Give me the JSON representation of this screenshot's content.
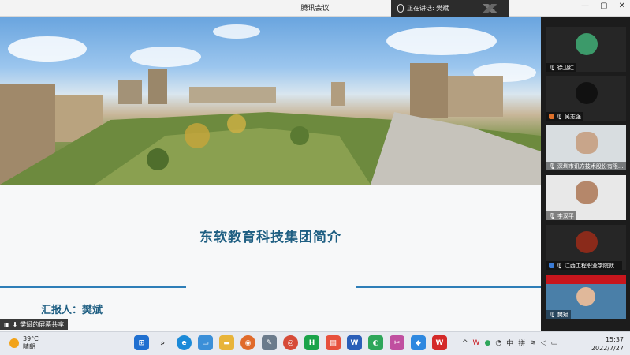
{
  "window": {
    "title": "腾讯会议",
    "speaking_label": "正在讲话: 樊斌",
    "controls": [
      "—",
      "▢",
      "✕"
    ]
  },
  "slide": {
    "heading": "东软教育科技集团简介",
    "reporter": "汇报人：樊斌"
  },
  "share_tag": "樊斌的屏幕共享",
  "participants": [
    {
      "name": "徐卫红",
      "accent": "#2e8b57"
    },
    {
      "name": "吴志强",
      "accent": "#e0712a"
    },
    {
      "name": "深圳市讯方技术股份有限...",
      "accent": "#3a7bd5"
    },
    {
      "name": "李汉平",
      "accent": "#3a7bd5"
    },
    {
      "name": "江西工程职业学院就...",
      "accent": "#3a7bd5"
    },
    {
      "name": "樊斌",
      "accent": "#2e8b57"
    }
  ],
  "taskbar": {
    "temperature": "39°C",
    "weather": "晴朗",
    "ime": "中",
    "ime2": "拼",
    "time": "15:37",
    "date": "2022/7/27"
  },
  "colors": {
    "accent": "#1e5e82",
    "rule": "#2e7eb8"
  }
}
